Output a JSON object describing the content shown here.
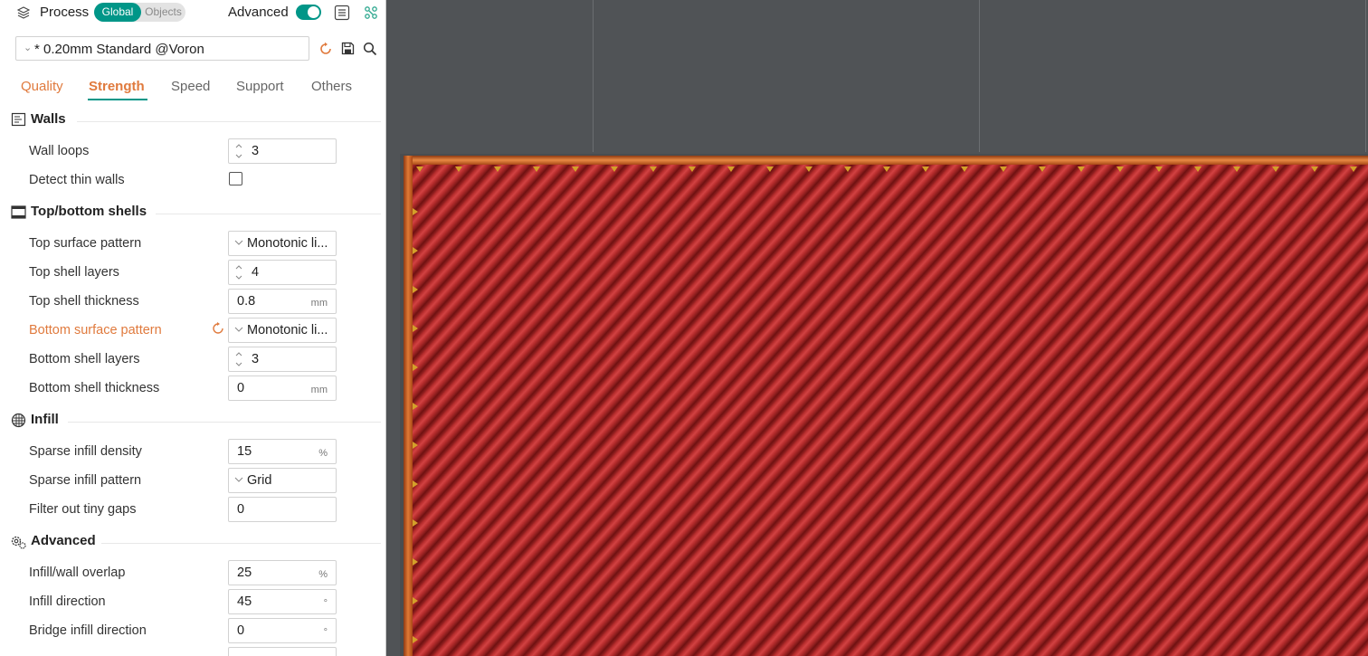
{
  "topbar": {
    "process_label": "Process",
    "global_label": "Global",
    "objects_label": "Objects",
    "advanced_label": "Advanced",
    "advanced_on": true
  },
  "preset": {
    "name": "* 0.20mm Standard @Voron"
  },
  "tabs": [
    "Quality",
    "Strength",
    "Speed",
    "Support",
    "Others"
  ],
  "active_tab": "Strength",
  "sections": {
    "walls": {
      "title": "Walls",
      "wall_loops": {
        "label": "Wall loops",
        "value": "3"
      },
      "detect_thin_walls": {
        "label": "Detect thin walls",
        "checked": false
      }
    },
    "shells": {
      "title": "Top/bottom shells",
      "top_surface_pattern": {
        "label": "Top surface pattern",
        "value": "Monotonic li..."
      },
      "top_shell_layers": {
        "label": "Top shell layers",
        "value": "4"
      },
      "top_shell_thickness": {
        "label": "Top shell thickness",
        "value": "0.8",
        "unit": "mm"
      },
      "bottom_surface_pattern": {
        "label": "Bottom surface pattern",
        "value": "Monotonic li..."
      },
      "bottom_shell_layers": {
        "label": "Bottom shell layers",
        "value": "3"
      },
      "bottom_shell_thickness": {
        "label": "Bottom shell thickness",
        "value": "0",
        "unit": "mm"
      }
    },
    "infill": {
      "title": "Infill",
      "sparse_infill_density": {
        "label": "Sparse infill density",
        "value": "15",
        "unit": "%"
      },
      "sparse_infill_pattern": {
        "label": "Sparse infill pattern",
        "value": "Grid"
      },
      "filter_tiny_gaps": {
        "label": "Filter out tiny gaps",
        "value": "0"
      }
    },
    "advanced": {
      "title": "Advanced",
      "infill_wall_overlap": {
        "label": "Infill/wall overlap",
        "value": "25",
        "unit": "%"
      },
      "infill_direction": {
        "label": "Infill direction",
        "value": "45",
        "unit": "°"
      },
      "bridge_infill_direction": {
        "label": "Bridge infill direction",
        "value": "0",
        "unit": "°"
      }
    }
  },
  "colors": {
    "accent_teal": "#009688",
    "modified_orange": "#e07a3d",
    "viewport_bg": "#505356",
    "infill_red": "#b83131",
    "wall_orange": "#e07a35"
  }
}
